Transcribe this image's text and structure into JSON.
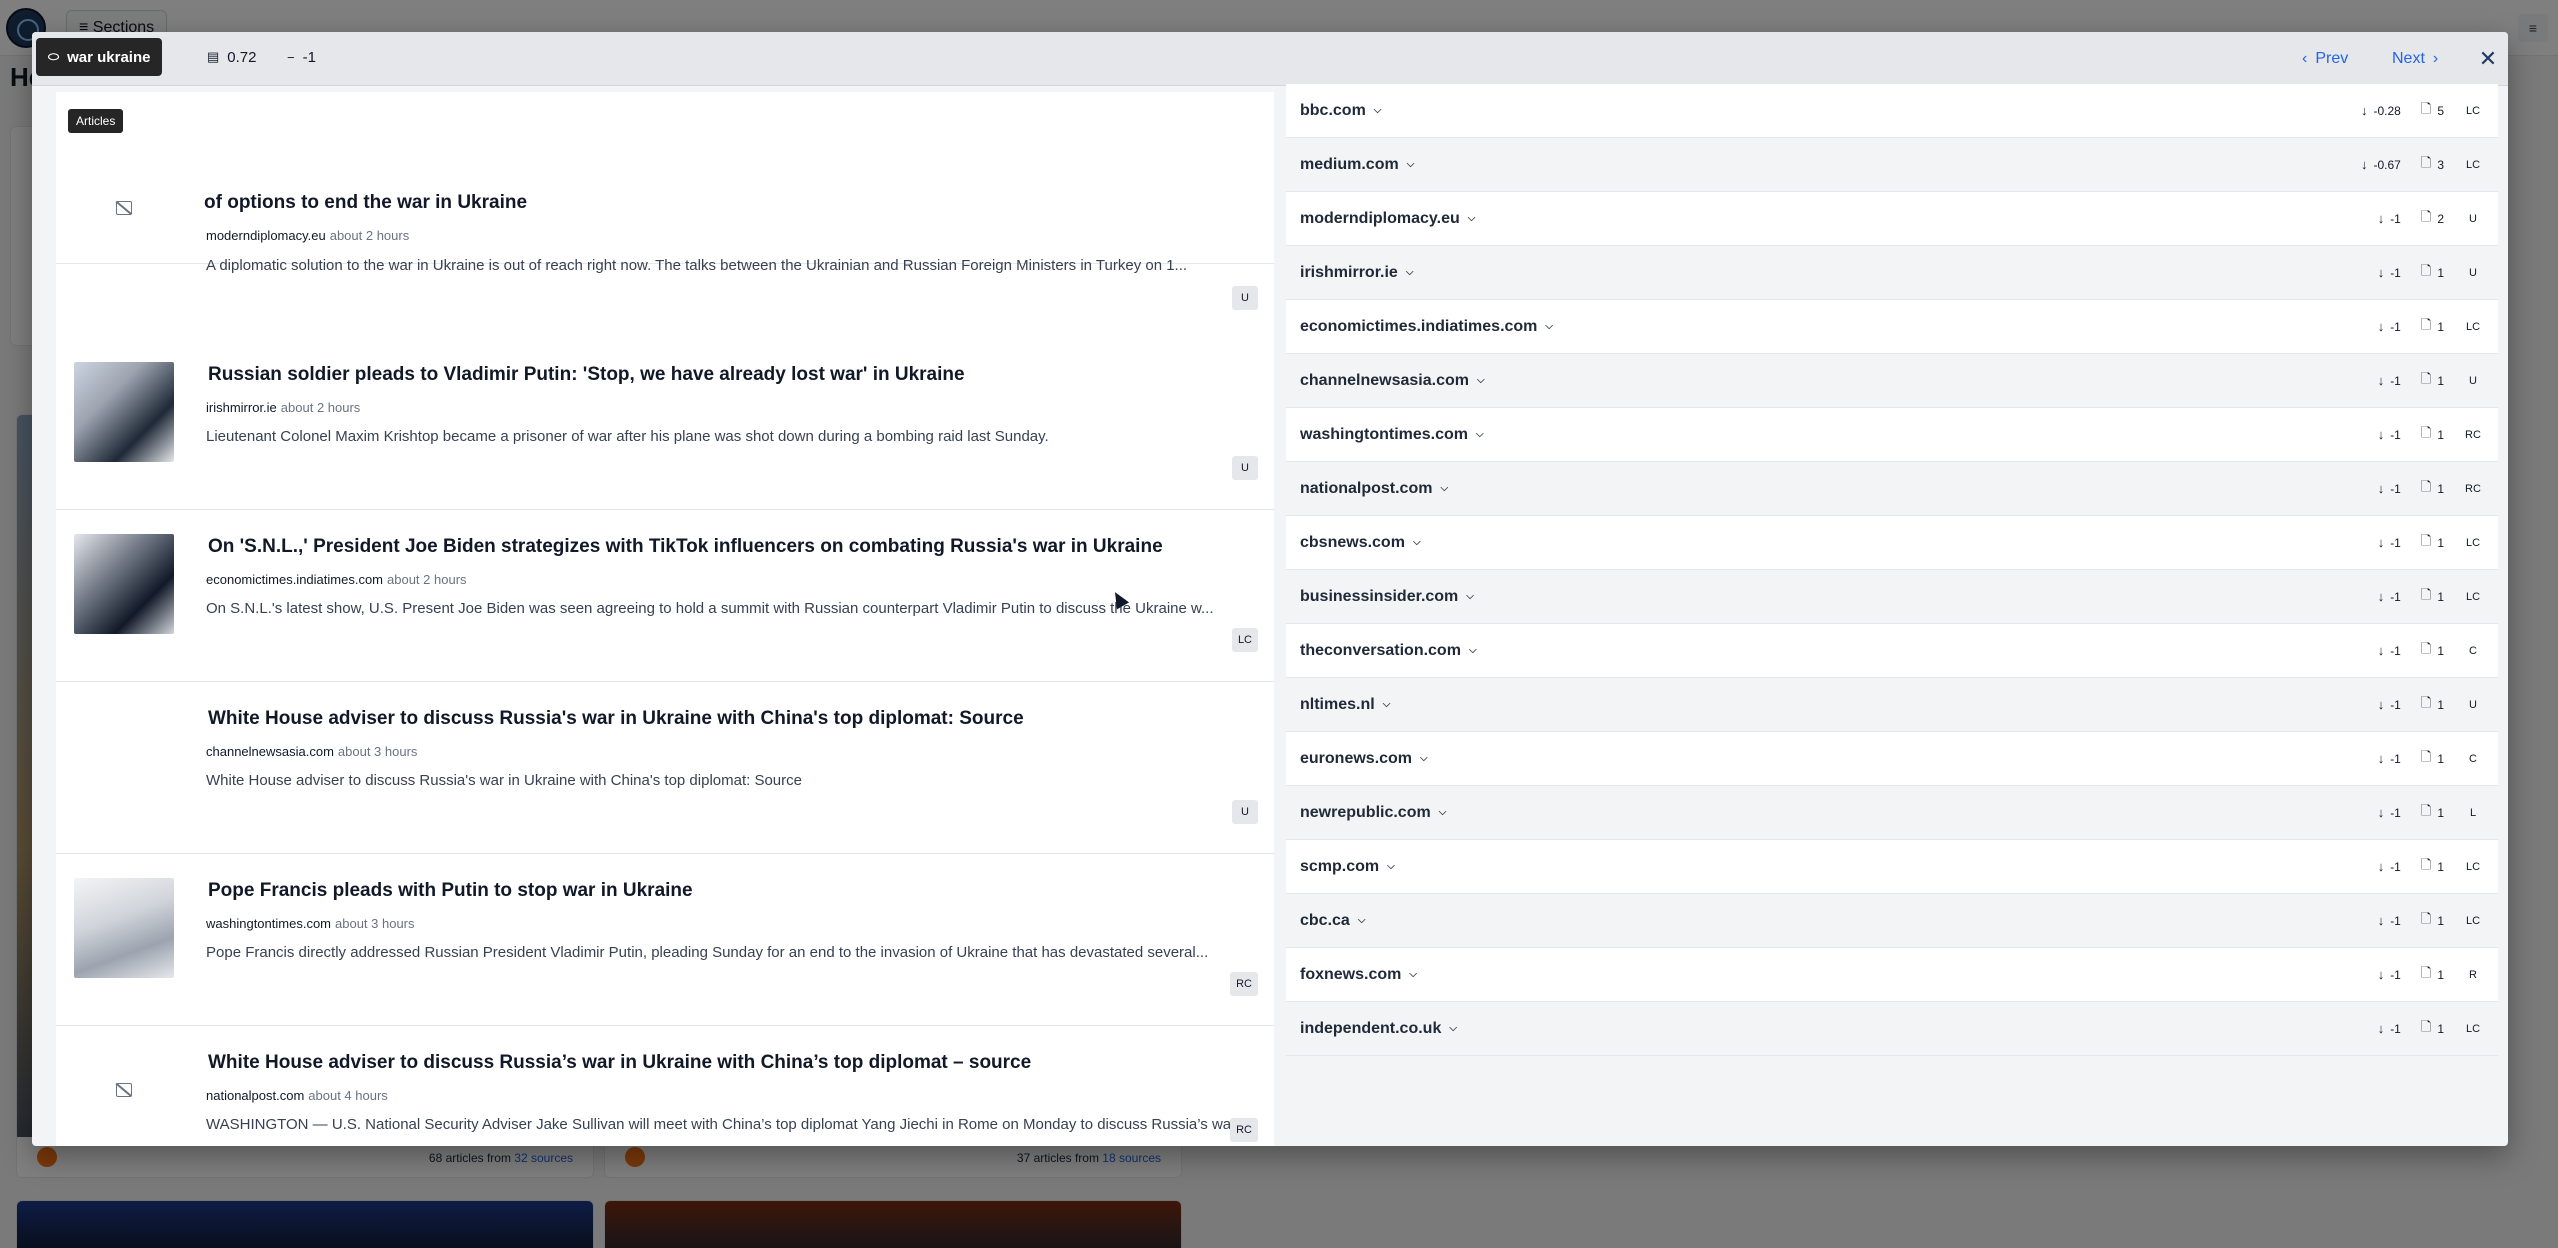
{
  "background": {
    "sections_label": "Sections",
    "heading": "Hea",
    "card1_footer": {
      "count": "68 articles from",
      "sources": "32 sources"
    },
    "card2_footer": {
      "count": "37 articles from",
      "sources": "18 sources"
    }
  },
  "modal": {
    "topic_chip": "war ukraine",
    "score_chip": "0.72",
    "sentiment_chip": "-1",
    "prev_label": "Prev",
    "next_label": "Next",
    "articles_tag": "Articles"
  },
  "articles": [
    {
      "title": "of options to end the war in Ukraine",
      "source": "moderndiplomacy.eu",
      "time": "about 2 hours",
      "desc": "A diplomatic solution to the war in Ukraine is out of reach right now. The talks between the Ukrainian and Russian Foreign Ministers in Turkey on 1...",
      "badge": "U",
      "image": "none"
    },
    {
      "title": "Russian soldier pleads to Vladimir Putin: 'Stop, we have already lost war' in Ukraine",
      "source": "irishmirror.ie",
      "time": "about 2 hours",
      "desc": "Lieutenant Colonel Maxim Krishtop became a prisoner of war after his plane was shot down during a bombing raid last Sunday.",
      "badge": "U",
      "image": "photo"
    },
    {
      "title": "On 'S.N.L.,' President Joe Biden strategizes with TikTok influencers on combating Russia's war in Ukraine",
      "source": "economictimes.indiatimes.com",
      "time": "about 2 hours",
      "desc": "On S.N.L.'s latest show, U.S. Present Joe Biden was seen agreeing to hold a summit with Russian counterpart Vladimir Putin to discuss the Ukraine w...",
      "badge": "LC",
      "image": "photo"
    },
    {
      "title": "White House adviser to discuss Russia's war in Ukraine with China's top diplomat: Source",
      "source": "channelnewsasia.com",
      "time": "about 3 hours",
      "desc": "White House adviser to discuss Russia's war in Ukraine with China's top diplomat: Source",
      "badge": "U",
      "image": "blank"
    },
    {
      "title": "Pope Francis pleads with Putin to stop war in Ukraine",
      "source": "washingtontimes.com",
      "time": "about 3 hours",
      "desc": "Pope Francis directly addressed Russian President Vladimir Putin, pleading Sunday for an end to the invasion of Ukraine that has devastated several...",
      "badge": "RC",
      "image": "photo"
    },
    {
      "title": "White House adviser to discuss Russia’s war in Ukraine with China’s top diplomat – source",
      "source": "nationalpost.com",
      "time": "about 4 hours",
      "desc": "WASHINGTON — U.S. National Security Adviser Jake Sullivan will meet with China’s top diplomat Yang Jiechi in Rome on Monday to discuss Russia’s war...",
      "badge": "RC",
      "image": "none"
    }
  ],
  "sources": [
    {
      "name": "bbc.com",
      "sentiment": "-0.28",
      "count": "5",
      "bias": "LC"
    },
    {
      "name": "medium.com",
      "sentiment": "-0.67",
      "count": "3",
      "bias": "LC"
    },
    {
      "name": "moderndiplomacy.eu",
      "sentiment": "-1",
      "count": "2",
      "bias": "U"
    },
    {
      "name": "irishmirror.ie",
      "sentiment": "-1",
      "count": "1",
      "bias": "U"
    },
    {
      "name": "economictimes.indiatimes.com",
      "sentiment": "-1",
      "count": "1",
      "bias": "LC"
    },
    {
      "name": "channelnewsasia.com",
      "sentiment": "-1",
      "count": "1",
      "bias": "U"
    },
    {
      "name": "washingtontimes.com",
      "sentiment": "-1",
      "count": "1",
      "bias": "RC"
    },
    {
      "name": "nationalpost.com",
      "sentiment": "-1",
      "count": "1",
      "bias": "RC"
    },
    {
      "name": "cbsnews.com",
      "sentiment": "-1",
      "count": "1",
      "bias": "LC"
    },
    {
      "name": "businessinsider.com",
      "sentiment": "-1",
      "count": "1",
      "bias": "LC"
    },
    {
      "name": "theconversation.com",
      "sentiment": "-1",
      "count": "1",
      "bias": "C"
    },
    {
      "name": "nltimes.nl",
      "sentiment": "-1",
      "count": "1",
      "bias": "U"
    },
    {
      "name": "euronews.com",
      "sentiment": "-1",
      "count": "1",
      "bias": "C"
    },
    {
      "name": "newrepublic.com",
      "sentiment": "-1",
      "count": "1",
      "bias": "L"
    },
    {
      "name": "scmp.com",
      "sentiment": "-1",
      "count": "1",
      "bias": "LC"
    },
    {
      "name": "cbc.ca",
      "sentiment": "-1",
      "count": "1",
      "bias": "LC"
    },
    {
      "name": "foxnews.com",
      "sentiment": "-1",
      "count": "1",
      "bias": "R"
    },
    {
      "name": "independent.co.uk",
      "sentiment": "-1",
      "count": "1",
      "bias": "LC"
    }
  ]
}
